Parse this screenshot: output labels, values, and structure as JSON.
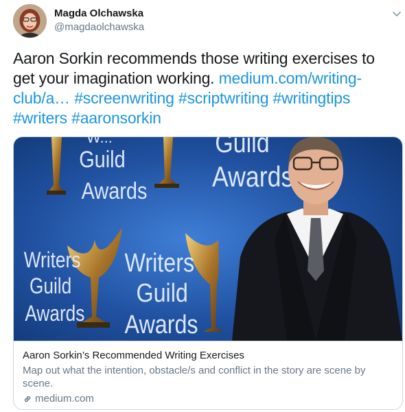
{
  "author": {
    "display_name": "Magda Olchawska",
    "handle": "@magdaolchawska",
    "avatar_icon": "person-avatar"
  },
  "menu": {
    "caret_icon": "chevron-down-icon"
  },
  "tweet": {
    "text": "Aaron Sorkin recommends those writing exercises to get your imagination working.",
    "link_text": "medium.com/writing-club/a…",
    "hashtags": [
      "#screenwriting",
      "#scriptwriting",
      "#writingtips",
      "#writers",
      "#aaronsorkin"
    ]
  },
  "card": {
    "image_texts": {
      "top_left_partial": "W...",
      "guild": "Guild",
      "awards": "Awards",
      "top_right_partial": "Guild",
      "writers": "Writers"
    },
    "title": "Aaron Sorkin’s Recommended Writing Exercises",
    "description": "Map out what the intention, obstacle/s and conflict in the story are scene by scene.",
    "domain": "medium.com",
    "domain_icon": "link-icon"
  },
  "colors": {
    "link": "#1b95e0",
    "text": "#14171a",
    "secondary": "#657786",
    "border": "#ccd6dd",
    "backdrop": "#1f4f9e"
  }
}
